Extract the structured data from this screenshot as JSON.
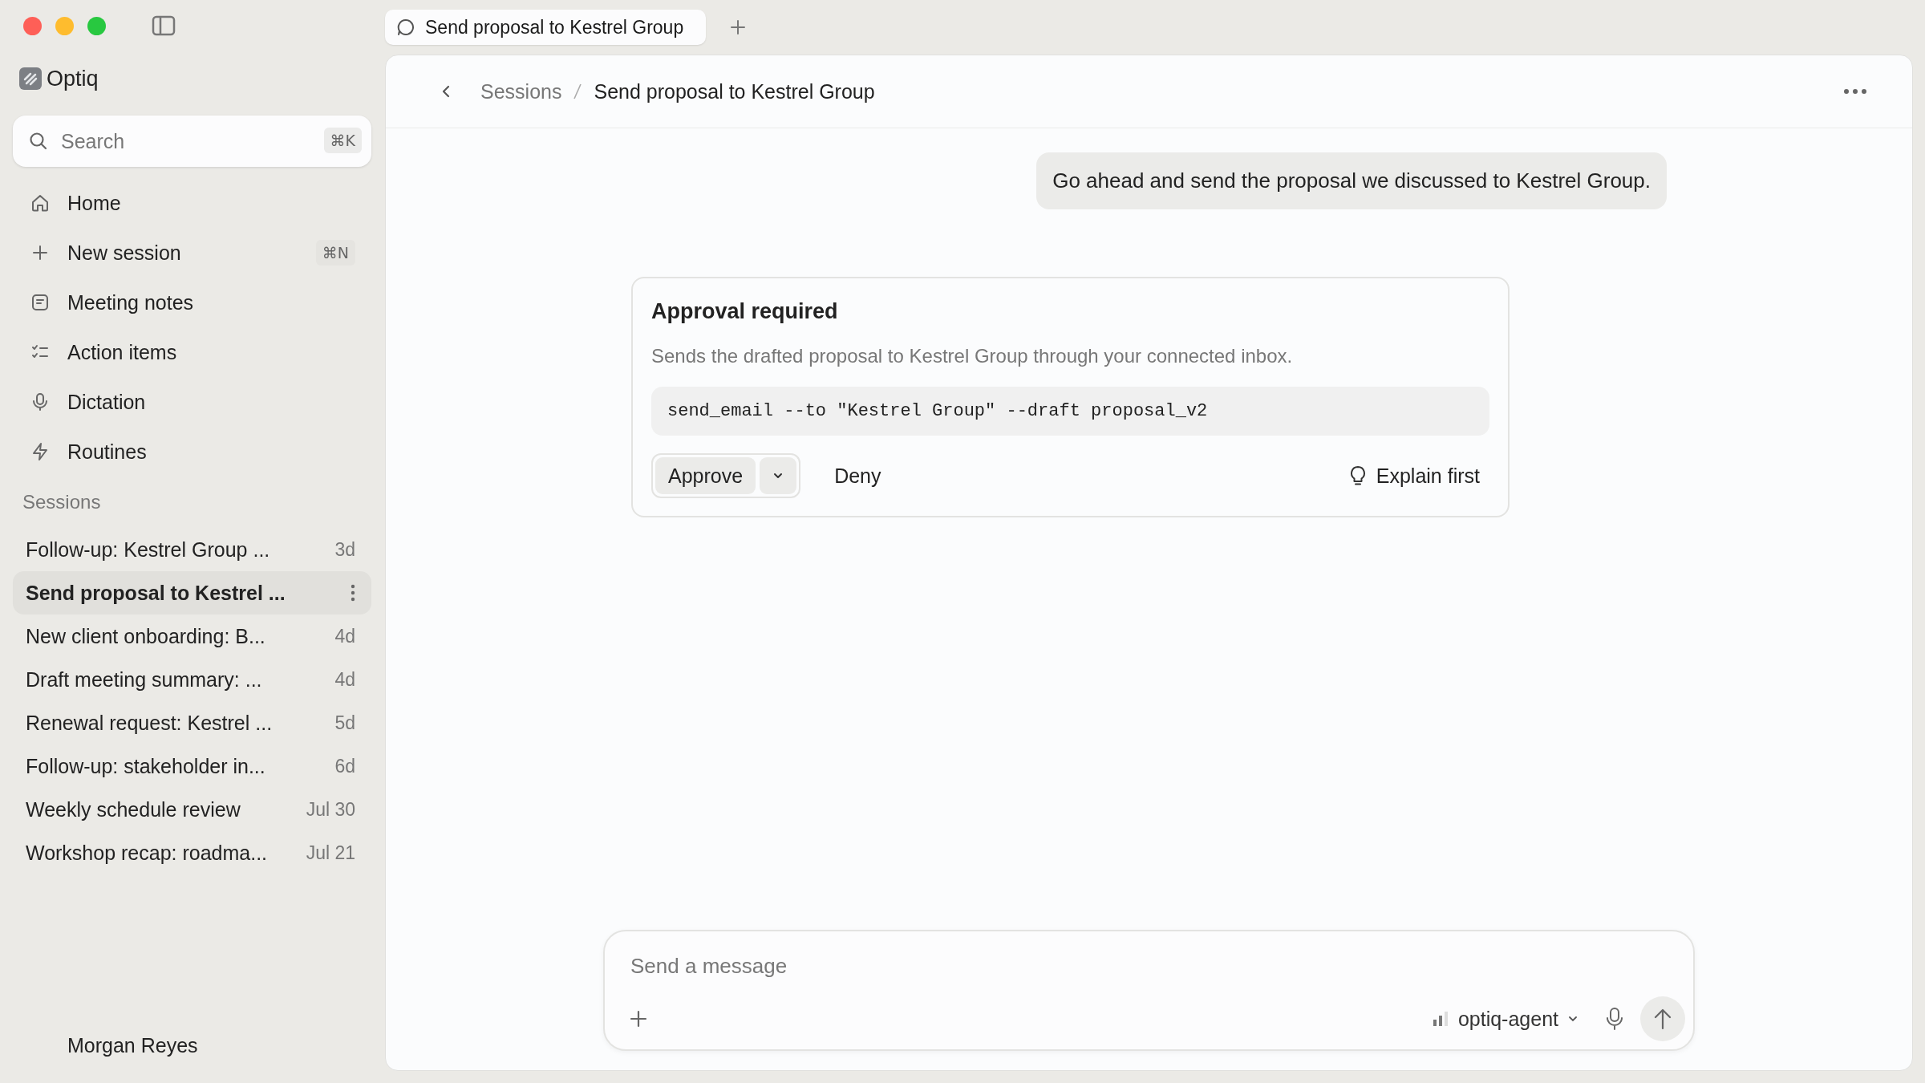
{
  "app": {
    "name": "Optiq"
  },
  "search": {
    "placeholder": "Search",
    "shortcut": "⌘K"
  },
  "nav": [
    {
      "label": "Home"
    },
    {
      "label": "New session",
      "shortcut": "⌘N"
    },
    {
      "label": "Meeting notes"
    },
    {
      "label": "Action items"
    },
    {
      "label": "Dictation"
    },
    {
      "label": "Routines"
    }
  ],
  "sessions_heading": "Sessions",
  "sessions": [
    {
      "title": "Follow-up: Kestrel Group ...",
      "time": "3d",
      "selected": false
    },
    {
      "title": "Send proposal to Kestrel ...",
      "selected": true
    },
    {
      "title": "New client onboarding: B...",
      "time": "4d",
      "selected": false
    },
    {
      "title": "Draft meeting summary: ...",
      "time": "4d",
      "selected": false
    },
    {
      "title": "Renewal request: Kestrel ...",
      "time": "5d",
      "selected": false
    },
    {
      "title": "Follow-up: stakeholder in...",
      "time": "6d",
      "selected": false
    },
    {
      "title": "Weekly schedule review",
      "time": "Jul 30",
      "selected": false
    },
    {
      "title": "Workshop recap: roadma...",
      "time": "Jul 21",
      "selected": false
    }
  ],
  "user": {
    "name": "Morgan Reyes"
  },
  "tabs": [
    {
      "label": "Send proposal to Kestrel Group",
      "selected": true
    }
  ],
  "breadcrumb": [
    "Sessions",
    "Send proposal to Kestrel Group"
  ],
  "messages": [
    {
      "kind": "user",
      "text": "Go ahead and send the proposal we discussed to Kestrel Group."
    },
    {
      "kind": "approval",
      "title": "Approval required",
      "description": "Sends the drafted proposal to Kestrel Group through your connected inbox.",
      "command": "send_email --to \"Kestrel Group\" --draft proposal_v2",
      "approve": "Approve",
      "deny": "Deny",
      "explain": "Explain first"
    }
  ],
  "composer": {
    "placeholder": "Send a message",
    "model": "optiq-agent"
  }
}
